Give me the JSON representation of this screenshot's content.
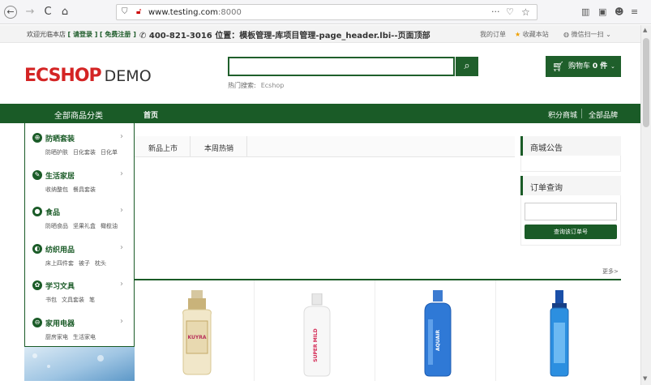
{
  "browser": {
    "url_host": "www.testing.com",
    "url_port": ":8000",
    "back_glyph": "←",
    "forward_glyph": "→",
    "reload_glyph": "C",
    "home_glyph": "⌂",
    "more_glyph": "···",
    "toolbar_icons": [
      "library-icon",
      "sidebar-icon",
      "account-icon",
      "menu-icon"
    ]
  },
  "topbar": {
    "welcome": "欢迎光临本店",
    "login": "[ 请登录 ]",
    "register": "[ 免费注册 ]",
    "phone_line": "400-821-3016 位置：模板管理-库项目管理-page_header.lbi--页面顶部",
    "my_orders": "我的订单",
    "favorite": "收藏本站",
    "wechat": "微信扫一扫"
  },
  "header": {
    "logo_main": "ECSHOP",
    "logo_demo": "DEMO",
    "search_value": "",
    "hot_label": "热门搜索:",
    "hot_keyword": "Ecshop",
    "cart_label": "购物车",
    "cart_count": "0 件"
  },
  "nav": {
    "all_categories": "全部商品分类",
    "home": "首页",
    "points_mall": "积分商城",
    "all_brands": "全部品牌"
  },
  "categories": [
    {
      "title": "防晒套装",
      "icon": "globe-icon",
      "glyph": "⊕",
      "subs": [
        "防晒护肤",
        "日化套装",
        "日化单"
      ]
    },
    {
      "title": "生活家居",
      "icon": "leaf-icon",
      "glyph": "✎",
      "subs": [
        "收纳整包",
        "餐具套装"
      ]
    },
    {
      "title": "食品",
      "icon": "apple-icon",
      "glyph": "●",
      "subs": [
        "防晒食品",
        "坚果礼盒",
        "橄榄油"
      ]
    },
    {
      "title": "纺织用品",
      "icon": "textile-icon",
      "glyph": "◐",
      "subs": [
        "床上四件套",
        "被子",
        "枕头"
      ]
    },
    {
      "title": "学习文具",
      "icon": "books-icon",
      "glyph": "✿",
      "subs": [
        "书包",
        "文具套装",
        "笔"
      ]
    },
    {
      "title": "家用电器",
      "icon": "appliance-icon",
      "glyph": "⊖",
      "subs": [
        "厨房家电",
        "生活家电"
      ]
    }
  ],
  "tabs": [
    "新品上市",
    "本周热销"
  ],
  "side": {
    "notice_title": "商城公告",
    "order_title": "订单查询",
    "order_input": "",
    "order_button": "查询该订单号"
  },
  "products": {
    "more": "更多>",
    "bottle_texts": [
      "KUYRA",
      "SUPER MILD",
      "AQUAIR",
      ""
    ]
  },
  "colors": {
    "brand_green": "#1a5b27",
    "logo_red": "#d42424"
  }
}
